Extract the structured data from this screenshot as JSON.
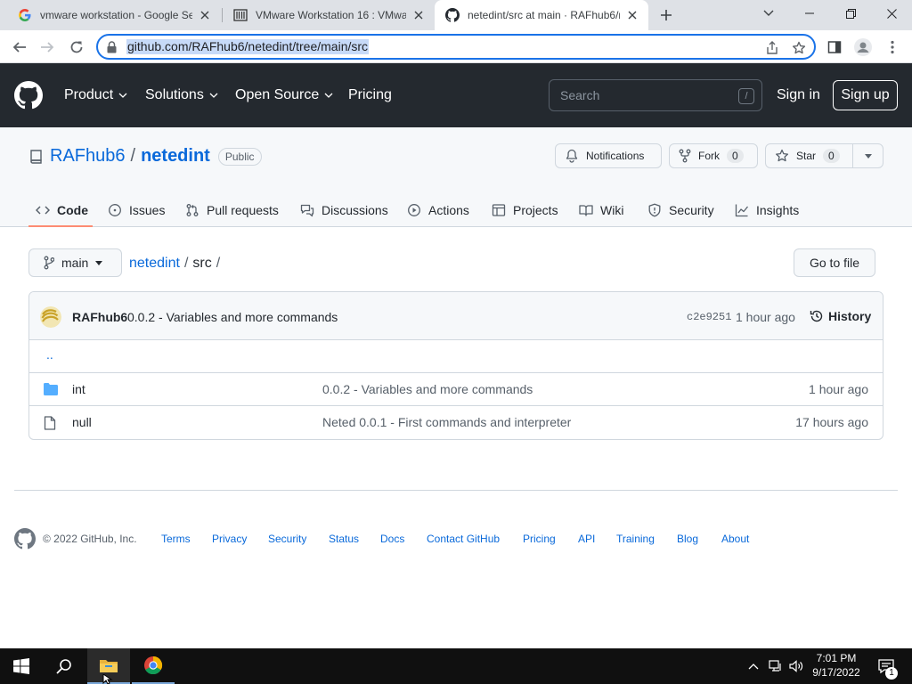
{
  "browser": {
    "tabs": [
      {
        "title": "vmware workstation - Google Se",
        "active": false
      },
      {
        "title": "VMware Workstation 16 : VMwar",
        "active": false
      },
      {
        "title": "netedint/src at main · RAFhub6/n",
        "active": true
      }
    ],
    "url": "github.com/RAFhub6/netedint/tree/main/src"
  },
  "header": {
    "nav": [
      {
        "label": "Product",
        "dropdown": true
      },
      {
        "label": "Solutions",
        "dropdown": true
      },
      {
        "label": "Open Source",
        "dropdown": true
      },
      {
        "label": "Pricing",
        "dropdown": false
      }
    ],
    "search_placeholder": "Search",
    "search_shortcut": "/",
    "sign_in": "Sign in",
    "sign_up": "Sign up"
  },
  "repo": {
    "owner": "RAFhub6",
    "separator": "/",
    "name": "netedint",
    "visibility": "Public",
    "notifications_label": "Notifications",
    "fork_label": "Fork",
    "fork_count": "0",
    "star_label": "Star",
    "star_count": "0",
    "tabs": [
      {
        "label": "Code",
        "icon": "code-icon",
        "active": true
      },
      {
        "label": "Issues",
        "icon": "issue-icon"
      },
      {
        "label": "Pull requests",
        "icon": "pull-request-icon"
      },
      {
        "label": "Discussions",
        "icon": "discussion-icon"
      },
      {
        "label": "Actions",
        "icon": "play-icon"
      },
      {
        "label": "Projects",
        "icon": "table-icon"
      },
      {
        "label": "Wiki",
        "icon": "book-icon"
      },
      {
        "label": "Security",
        "icon": "shield-icon"
      },
      {
        "label": "Insights",
        "icon": "graph-icon"
      }
    ]
  },
  "content": {
    "branch": "main",
    "breadcrumb_repo": "netedint",
    "breadcrumb_path": "src",
    "breadcrumb_sep": "/",
    "go_to_file": "Go to file",
    "commit": {
      "author": "RAFhub6",
      "message": "0.0.2 - Variables and more commands",
      "sha": "c2e9251",
      "time": "1 hour ago",
      "history": "History"
    },
    "parent_dir": "..",
    "files": [
      {
        "name": "int",
        "type": "folder",
        "message": "0.0.2 - Variables and more commands",
        "time": "1 hour ago"
      },
      {
        "name": "null",
        "type": "file",
        "message": "Neted 0.0.1 - First commands and interpreter",
        "time": "17 hours ago"
      }
    ]
  },
  "footer": {
    "copyright": "© 2022 GitHub, Inc.",
    "links": [
      "Terms",
      "Privacy",
      "Security",
      "Status",
      "Docs",
      "Contact GitHub",
      "Pricing",
      "API",
      "Training",
      "Blog",
      "About"
    ]
  },
  "taskbar": {
    "time": "7:01 PM",
    "date": "9/17/2022",
    "notification_count": "1"
  },
  "colors": {
    "github_header": "#24292f",
    "link": "#0969da",
    "active_tab_underline": "#fd8c73",
    "omnibox_focus": "#1a73e8",
    "folder": "#54aeff"
  }
}
